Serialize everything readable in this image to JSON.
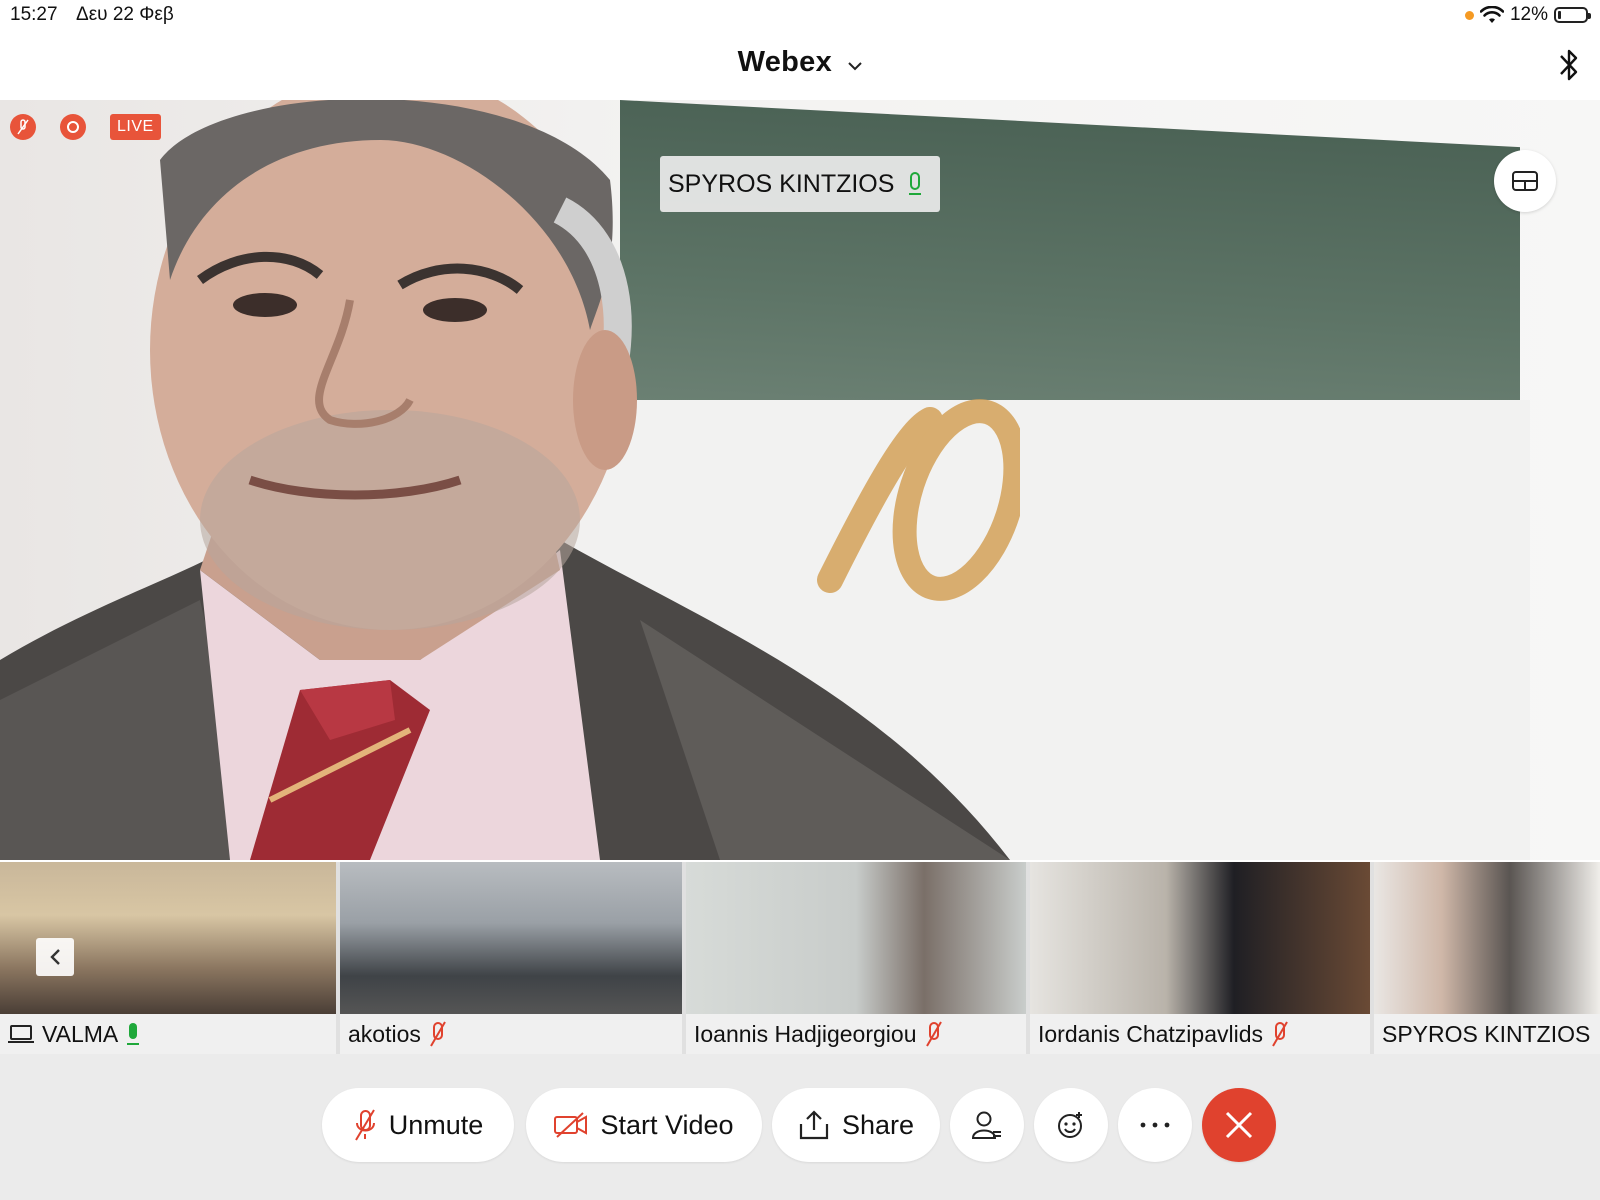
{
  "status_bar": {
    "time": "15:27",
    "date": "Δευ 22 Φεβ",
    "battery": "12%",
    "battery_level": 0.12,
    "icons": [
      "orange-dot-indicator",
      "wifi-icon",
      "battery-icon"
    ]
  },
  "header": {
    "title": "Webex",
    "icons": [
      "chevron-down-icon",
      "bluetooth-icon"
    ]
  },
  "main_video": {
    "indicators": [
      "muted-mic-icon",
      "recording-icon"
    ],
    "live_label": "LIVE",
    "speaker_name": "SPYROS KINTZIOS",
    "speaker_mic_icon": "mic-on-icon",
    "layout_icon": "grid-layout-icon"
  },
  "participants": [
    {
      "name": "VALMA",
      "device_icon": "laptop-icon",
      "mic": "mic-on-icon"
    },
    {
      "name": "akotios",
      "mic": "mic-muted-icon"
    },
    {
      "name": "Ioannis Hadjigeorgiou",
      "mic": "mic-muted-icon"
    },
    {
      "name": "Iordanis Chatzipavlids",
      "mic": "mic-muted-icon"
    },
    {
      "name": "SPYROS KINTZIOS"
    }
  ],
  "controls": {
    "unmute": "Unmute",
    "start_video": "Start Video",
    "share": "Share",
    "icons": [
      "mic-muted-icon",
      "video-off-icon",
      "share-icon",
      "participants-icon",
      "reactions-icon",
      "more-icon",
      "end-call-icon"
    ]
  },
  "colors": {
    "accent_red": "#e0422e",
    "live_red": "#e8543a",
    "mic_green": "#1fa83a",
    "control_bg": "#ebebeb"
  }
}
